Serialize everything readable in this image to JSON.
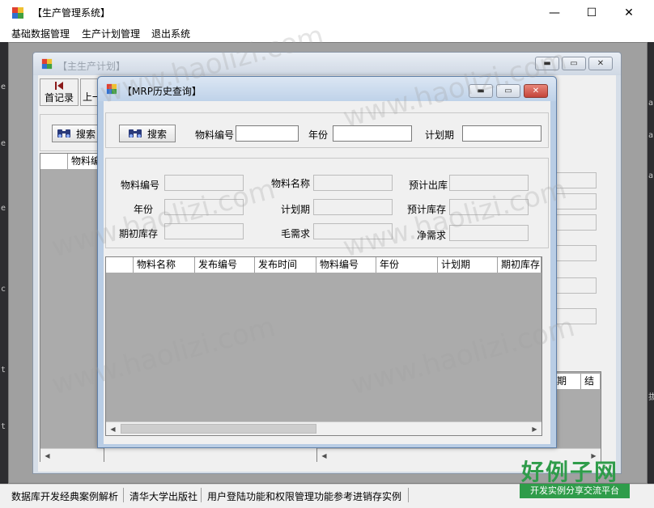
{
  "app": {
    "title": "【生产管理系统】",
    "controls": {
      "minimize": "—",
      "maximize": "☐",
      "close": "✕"
    }
  },
  "menu": {
    "items": [
      "基础数据管理",
      "生产计划管理",
      "退出系统"
    ]
  },
  "status_bar": {
    "cells": [
      "数据库开发经典案例解析",
      "清华大学出版社",
      "用户登陆功能和权限管理功能参考进销存实例"
    ]
  },
  "child_plan": {
    "title": "【主生产计划】",
    "toolbar": {
      "first_record": "首记录",
      "previous_record": "上一"
    },
    "search_label": "搜索",
    "grid_col_1": "物料编",
    "grid_tail_cols": [
      "期",
      "结"
    ]
  },
  "mrp_window": {
    "title": "【MRP历史查询】",
    "search": {
      "button": "搜索",
      "material_code_label": "物料编号",
      "year_label": "年份",
      "period_label": "计划期",
      "material_code_value": "",
      "year_value": "",
      "period_value": ""
    },
    "detail": {
      "material_code": "物料编号",
      "material_name": "物料名称",
      "expected_out": "预计出库",
      "year": "年份",
      "period": "计划期",
      "expected_stock": "预计库存",
      "opening_stock": "期初库存",
      "gross_demand": "毛需求",
      "net_demand": "净需求"
    },
    "grid_columns": [
      "物料名称",
      "发布编号",
      "发布时间",
      "物料编号",
      "年份",
      "计划期",
      "期初库存"
    ]
  },
  "watermark": {
    "text": "www.haolizi.com"
  },
  "brand": {
    "name": "好例子网",
    "slogan": "开发实例分享交流平台"
  },
  "colors": {
    "accent_brand": "#2f9c4a",
    "mdi_bg": "#a0a0a0",
    "grid_bg": "#ababab"
  }
}
